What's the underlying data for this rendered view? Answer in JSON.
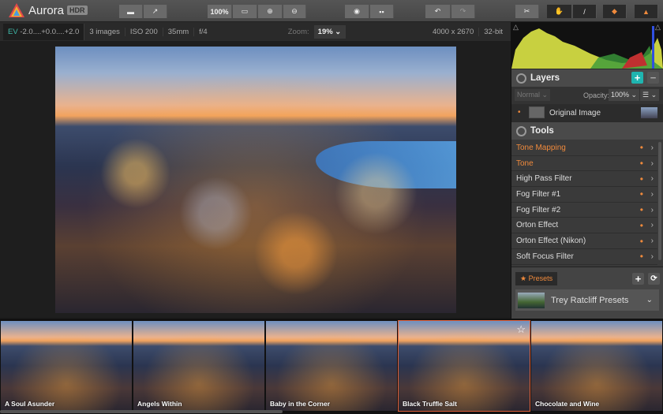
{
  "app": {
    "name": "Aurora",
    "badge": "HDR"
  },
  "toolbar": {
    "zoom_100": "100%",
    "icons": [
      "open-folder-icon",
      "share-icon",
      "fit-screen-icon",
      "zoom-in-icon",
      "zoom-out-icon",
      "eye-icon",
      "compare-icon",
      "undo-icon",
      "redo-icon",
      "crop-icon",
      "hand-icon",
      "brush-icon",
      "layers-icon",
      "histogram-icon"
    ]
  },
  "info": {
    "ev_label": "EV",
    "ev": "-2.0....+0.0....+2.0",
    "images": "3 images",
    "iso": "ISO 200",
    "focal": "35mm",
    "aperture": "f/4",
    "zoom_label": "Zoom:",
    "zoom_value": "19%",
    "dimensions": "4000 x 2670",
    "bit_depth": "32-bit"
  },
  "layers": {
    "title": "Layers",
    "blend": "Normal",
    "opacity_label": "Opacity:",
    "opacity": "100%",
    "layer_name": "Original Image"
  },
  "tools": {
    "title": "Tools",
    "items": [
      {
        "label": "Tone Mapping",
        "active": true
      },
      {
        "label": "Tone",
        "active": true
      },
      {
        "label": "High Pass Filter",
        "active": false
      },
      {
        "label": "Fog Filter #1",
        "active": false
      },
      {
        "label": "Fog Filter #2",
        "active": false
      },
      {
        "label": "Orton Effect",
        "active": false
      },
      {
        "label": "Orton Effect (Nikon)",
        "active": false
      },
      {
        "label": "Soft Focus Filter",
        "active": false
      }
    ]
  },
  "presets": {
    "tab": "Presets",
    "collection": "Trey Ratcliff Presets"
  },
  "filmstrip": [
    {
      "label": "A Soul Asunder"
    },
    {
      "label": "Angels Within"
    },
    {
      "label": "Baby in the Corner"
    },
    {
      "label": "Black Truffle Salt",
      "selected": true
    },
    {
      "label": "Chocolate and Wine"
    }
  ],
  "colors": {
    "accent": "#f08a3c",
    "add": "#1fb5b0"
  }
}
